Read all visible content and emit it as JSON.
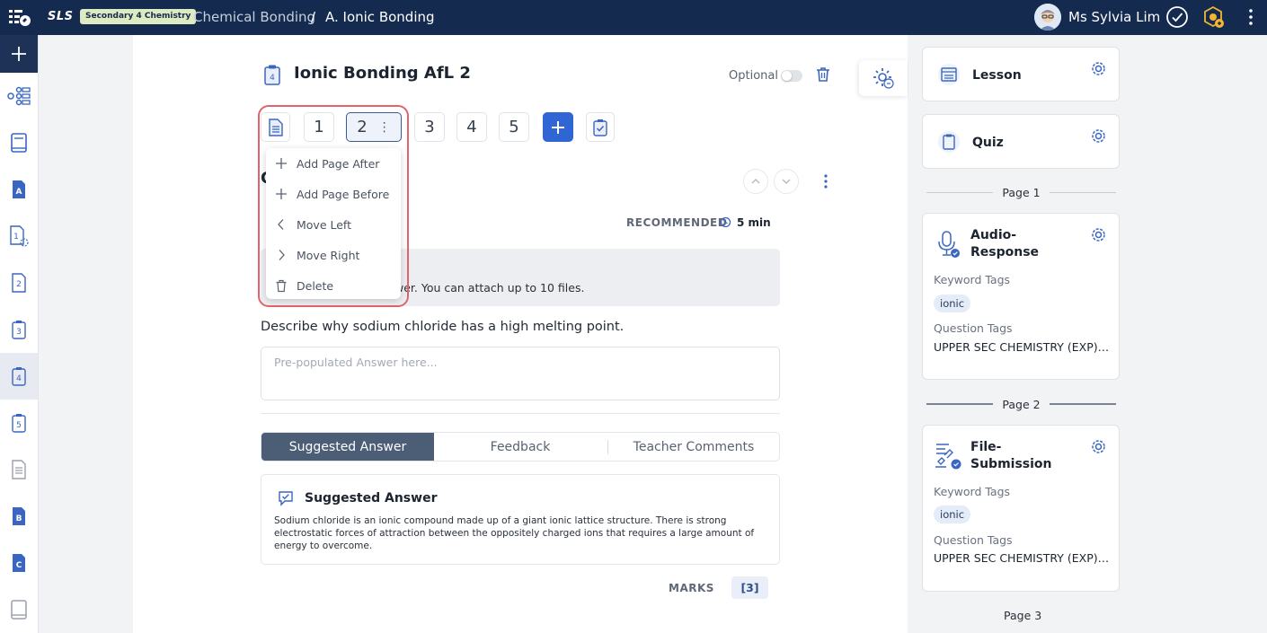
{
  "topbar": {
    "brand": "SLS",
    "subject_badge": "Secondary 4 Chemistry",
    "breadcrumb_1": "Chemical Bonding",
    "breadcrumb_sep": "/",
    "breadcrumb_2": "A. Ionic Bonding",
    "user_name": "Ms Sylvia Lim",
    "colors": {
      "bar": "#142a4f",
      "badge": "#dcebc1"
    }
  },
  "rail": {
    "items": [
      "add-icon",
      "map-icon",
      "book-icon",
      "section-a-icon",
      "activity-1-icon",
      "activity-2-icon",
      "activity-3-icon",
      "activity-4-icon",
      "activity-5-icon",
      "document-icon",
      "section-b-icon",
      "section-c-icon",
      "notebook-icon"
    ],
    "active_index": 7
  },
  "activity": {
    "title": "Ionic Bonding AfL 2",
    "title_badge": "4",
    "optional_label": "Optional",
    "optional_on": false
  },
  "pages": {
    "tabs": [
      "1",
      "2",
      "3",
      "4",
      "5"
    ],
    "active": "2",
    "kebab": "⋮"
  },
  "page_menu": {
    "items": [
      {
        "label": "Add Page After",
        "icon": "plus-icon"
      },
      {
        "label": "Add Page Before",
        "icon": "plus-icon"
      },
      {
        "label": "Move Left",
        "icon": "chevron-left-icon"
      },
      {
        "label": "Move Right",
        "icon": "chevron-right-icon"
      },
      {
        "label": "Delete",
        "icon": "trash-icon"
      }
    ]
  },
  "question": {
    "partial_heading": "C",
    "recommended_label": "RECOMMENDED",
    "recommended_time": "5 min",
    "instruction_text": "wer. You can attach up to 10 files.",
    "prompt": "Describe why sodium chloride has a high melting point.",
    "answer_placeholder": "Pre-populated Answer here..."
  },
  "answer_tabs": {
    "tabs": [
      "Suggested Answer",
      "Feedback",
      "Teacher Comments"
    ],
    "active": "Suggested Answer"
  },
  "suggested_answer": {
    "title": "Suggested Answer",
    "body": "Sodium chloride is an ionic compound made up of a giant ionic lattice structure. There is strong electrostatic forces of attraction between the oppositely charged ions that requires a large amount of energy to overcome."
  },
  "marks": {
    "label": "MARKS",
    "value": "[3]"
  },
  "right_panel": {
    "lesson_label": "Lesson",
    "quiz_label": "Quiz",
    "page1_label": "Page 1",
    "page2_label": "Page 2",
    "page3_label": "Page 3",
    "card1": {
      "name": "Audio-Response",
      "keyword_tags_label": "Keyword Tags",
      "keyword_tag": "ionic",
      "question_tags_label": "Question Tags",
      "question_tag": "UPPER SEC CHEMISTRY (EXP) (2..."
    },
    "card2": {
      "name": "File-Submission",
      "keyword_tags_label": "Keyword Tags",
      "keyword_tag": "ionic",
      "question_tags_label": "Question Tags",
      "question_tag": "UPPER SEC CHEMISTRY (EXP) (2..."
    }
  }
}
